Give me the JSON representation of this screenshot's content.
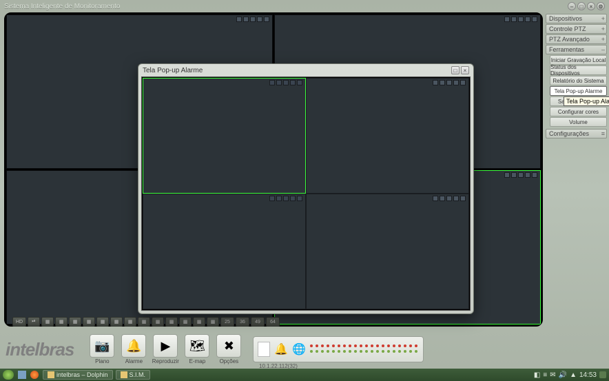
{
  "app_title": "Sistema Inteligente de Monitoramento",
  "window_buttons": [
    "–",
    "□",
    "×",
    "⚙"
  ],
  "sidebar": {
    "panels": [
      {
        "label": "Dispositivos",
        "collapsed": true
      },
      {
        "label": "Controle PTZ",
        "collapsed": true
      },
      {
        "label": "PTZ Avançado",
        "collapsed": true
      },
      {
        "label": "Ferramentas",
        "collapsed": false
      }
    ],
    "tools": [
      "Iniciar Gravação Local",
      "Status dos Dispositivos",
      "Relatório do Sistema",
      "Tela Pop-up Alarme",
      "Saída de Alarme",
      "Configurar cores",
      "Volume"
    ],
    "tooltip": "Tela Pop-up Alarme",
    "config_label": "Configurações"
  },
  "modal": {
    "title": "Tela Pop-up Alarme",
    "buttons": [
      "□",
      "×"
    ]
  },
  "layout_bar": {
    "buttons": [
      "HD",
      "⏯",
      "▦",
      "▦",
      "▦",
      "▦",
      "▦",
      "▦",
      "▦",
      "▦",
      "▦",
      "▦",
      "▦",
      "▦",
      "▦",
      "25",
      "36",
      "49",
      "64"
    ]
  },
  "app_buttons": [
    {
      "icon": "📷",
      "label": "Plano"
    },
    {
      "icon": "🔔",
      "label": "Alarme"
    },
    {
      "icon": "▶",
      "label": "Reproduzir"
    },
    {
      "icon": "🗺",
      "label": "E-map"
    },
    {
      "icon": "✖",
      "label": "Opções"
    }
  ],
  "brand": "intelbras",
  "status": {
    "ip": "10.1.22.112(32)"
  },
  "taskbar": {
    "tasks": [
      {
        "label": "intelbras – Dolphin"
      },
      {
        "label": "S.I.M."
      }
    ],
    "clock": "14:53",
    "tray_icons": [
      "◧",
      "≡",
      "✉",
      "🔊",
      "▲"
    ]
  }
}
